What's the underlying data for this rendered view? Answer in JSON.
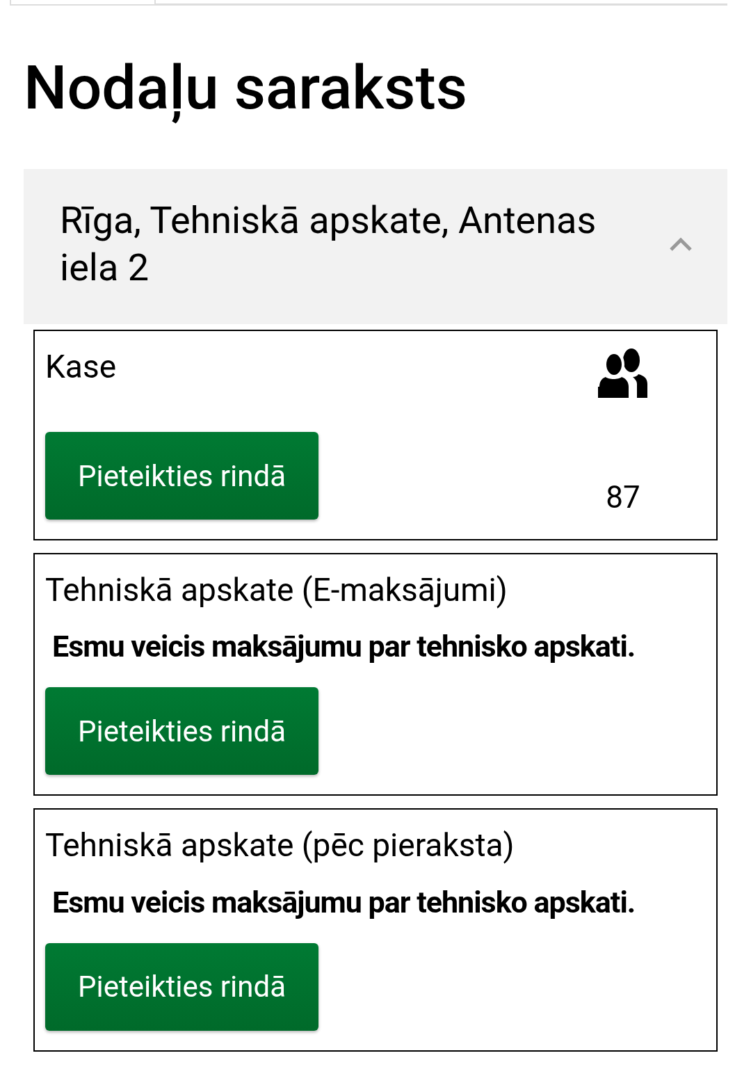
{
  "page_title": "Nodaļu saraksts",
  "branch": {
    "title": "Rīga, Tehniskā apskate, Antenas iela 2",
    "expanded": true
  },
  "services": [
    {
      "kind": "queue",
      "name": "Kase",
      "button": "Pieteikties rindā",
      "count": "87"
    },
    {
      "kind": "note",
      "name": "Tehniskā apskate (E-maksājumi)",
      "note": "Esmu veicis maksājumu par tehnisko apskati.",
      "button": "Pieteikties rindā"
    },
    {
      "kind": "note",
      "name": "Tehniskā apskate (pēc pieraksta)",
      "note": "Esmu veicis maksājumu par tehnisko apskati.",
      "button": "Pieteikties rindā"
    }
  ]
}
